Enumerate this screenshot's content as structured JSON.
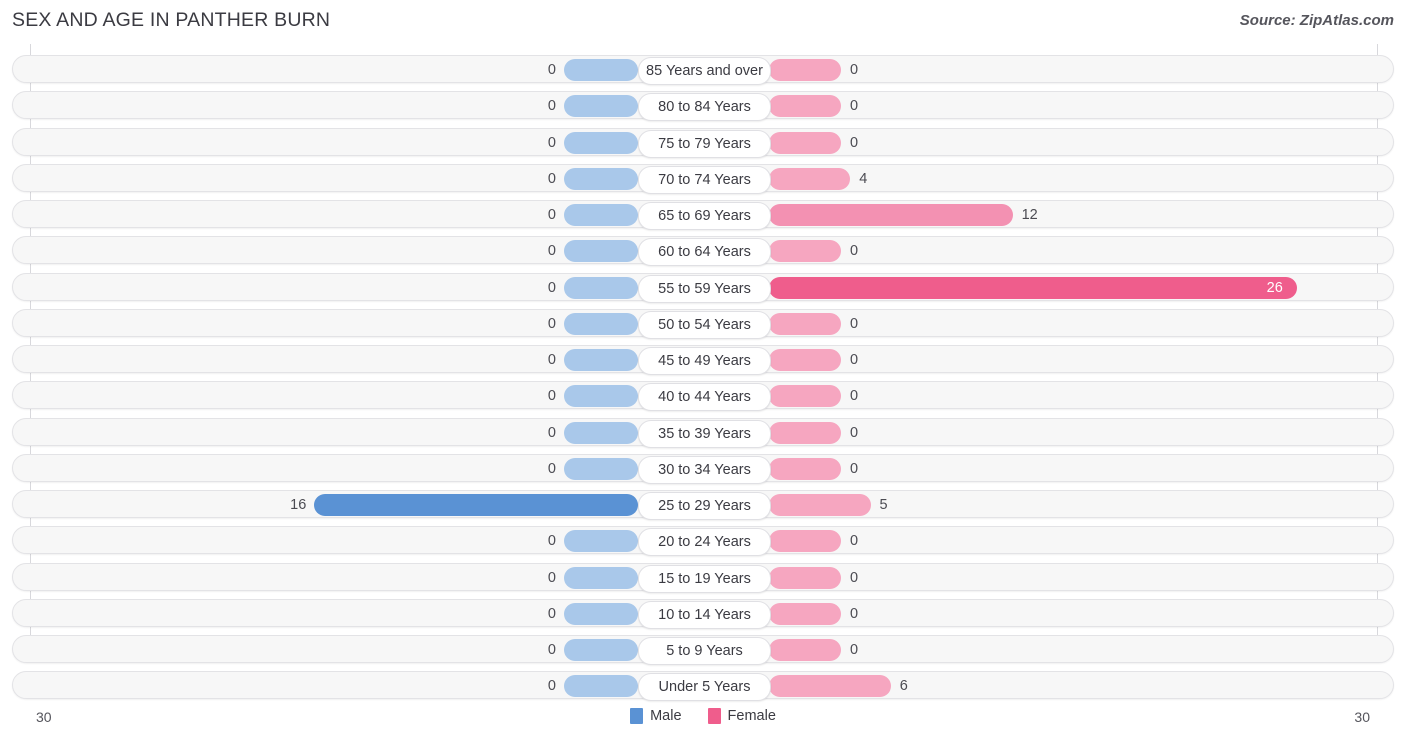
{
  "header": {
    "title": "SEX AND AGE IN PANTHER BURN",
    "source": "Source: ZipAtlas.com"
  },
  "legend": {
    "male_label": "Male",
    "female_label": "Female",
    "male_color": "#5a92d4",
    "female_color": "#ef5d8c"
  },
  "axis": {
    "left_max_label": "30",
    "right_max_label": "30"
  },
  "chart_data": {
    "type": "bar",
    "subtype": "population-pyramid",
    "title": "SEX AND AGE IN PANTHER BURN",
    "source": "Source: ZipAtlas.com",
    "xlabel": "",
    "ylabel": "",
    "xlim": [
      30,
      30
    ],
    "axis_max": 30,
    "grid": false,
    "legend_position": "bottom-center",
    "categories": [
      "85 Years and over",
      "80 to 84 Years",
      "75 to 79 Years",
      "70 to 74 Years",
      "65 to 69 Years",
      "60 to 64 Years",
      "55 to 59 Years",
      "50 to 54 Years",
      "45 to 49 Years",
      "40 to 44 Years",
      "35 to 39 Years",
      "30 to 34 Years",
      "25 to 29 Years",
      "20 to 24 Years",
      "15 to 19 Years",
      "10 to 14 Years",
      "5 to 9 Years",
      "Under 5 Years"
    ],
    "series": [
      {
        "name": "Male",
        "color": "#5a92d4",
        "values": [
          0,
          0,
          0,
          0,
          0,
          0,
          0,
          0,
          0,
          0,
          0,
          0,
          16,
          0,
          0,
          0,
          0,
          0
        ]
      },
      {
        "name": "Female",
        "color": "#ef5d8c",
        "values": [
          0,
          0,
          0,
          4,
          12,
          0,
          26,
          0,
          0,
          0,
          0,
          0,
          5,
          0,
          0,
          0,
          0,
          6
        ]
      }
    ]
  },
  "rows": [
    {
      "age": "85 Years and over",
      "male": "0",
      "female": "0"
    },
    {
      "age": "80 to 84 Years",
      "male": "0",
      "female": "0"
    },
    {
      "age": "75 to 79 Years",
      "male": "0",
      "female": "0"
    },
    {
      "age": "70 to 74 Years",
      "male": "0",
      "female": "4"
    },
    {
      "age": "65 to 69 Years",
      "male": "0",
      "female": "12"
    },
    {
      "age": "60 to 64 Years",
      "male": "0",
      "female": "0"
    },
    {
      "age": "55 to 59 Years",
      "male": "0",
      "female": "26"
    },
    {
      "age": "50 to 54 Years",
      "male": "0",
      "female": "0"
    },
    {
      "age": "45 to 49 Years",
      "male": "0",
      "female": "0"
    },
    {
      "age": "40 to 44 Years",
      "male": "0",
      "female": "0"
    },
    {
      "age": "35 to 39 Years",
      "male": "0",
      "female": "0"
    },
    {
      "age": "30 to 34 Years",
      "male": "0",
      "female": "0"
    },
    {
      "age": "25 to 29 Years",
      "male": "16",
      "female": "5"
    },
    {
      "age": "20 to 24 Years",
      "male": "0",
      "female": "0"
    },
    {
      "age": "15 to 19 Years",
      "male": "0",
      "female": "0"
    },
    {
      "age": "10 to 14 Years",
      "male": "0",
      "female": "0"
    },
    {
      "age": "5 to 9 Years",
      "male": "0",
      "female": "0"
    },
    {
      "age": "Under 5 Years",
      "male": "0",
      "female": "6"
    }
  ]
}
